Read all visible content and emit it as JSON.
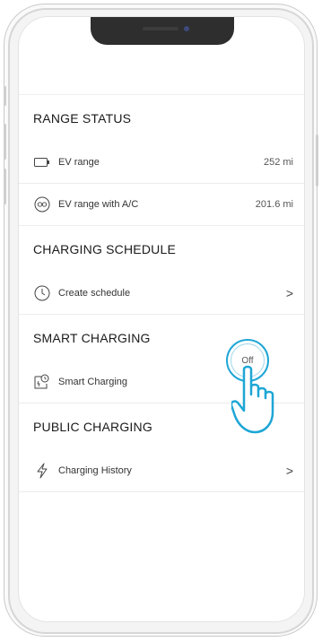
{
  "range_status": {
    "header": "RANGE STATUS",
    "rows": [
      {
        "label": "EV range",
        "value": "252 mi"
      },
      {
        "label": "EV range with A/C",
        "value": "201.6 mi"
      }
    ]
  },
  "charging_schedule": {
    "header": "CHARGING SCHEDULE",
    "rows": [
      {
        "label": "Create schedule",
        "chevron": ">"
      }
    ]
  },
  "smart_charging": {
    "header": "SMART CHARGING",
    "rows": [
      {
        "label": "Smart Charging",
        "value": "Off"
      }
    ]
  },
  "public_charging": {
    "header": "PUBLIC CHARGING",
    "rows": [
      {
        "label": "Charging History",
        "chevron": ">"
      }
    ]
  },
  "icons": {
    "ev_range": "battery-icon",
    "ev_range_ac": "fan-icon",
    "create_schedule": "clock-icon",
    "smart_charging": "smart-charging-icon",
    "charging_history": "lightning-icon",
    "tap_gesture": "hand-pointer-icon"
  },
  "colors": {
    "accent": "#1ea6d6",
    "divider": "#ececec",
    "text": "#1a1a1a"
  }
}
